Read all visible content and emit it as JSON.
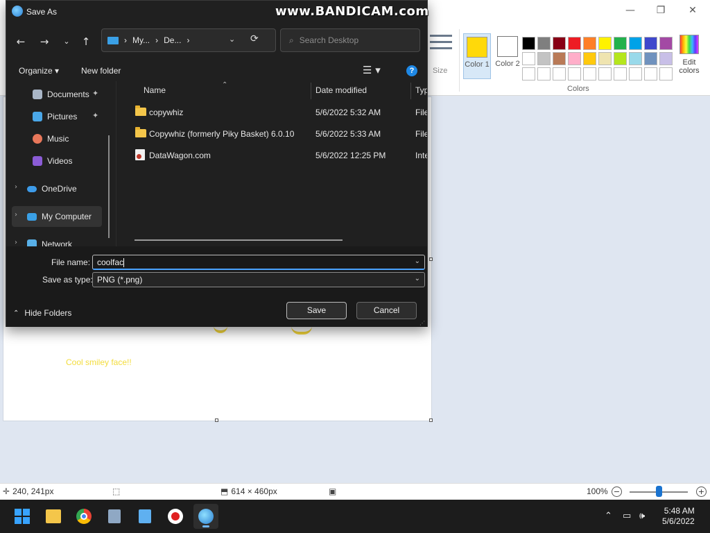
{
  "paint": {
    "window_controls": {
      "minimize": "—",
      "maximize": "❐",
      "close": "✕"
    },
    "ribbon": {
      "size_label": "Size",
      "color1_label": "Color 1",
      "color2_label": "Color 2",
      "colors_group_label": "Colors",
      "edit_colors_label": "Edit colors",
      "color1_value": "#ffd90a",
      "color2_value": "#ffffff",
      "palette_row1": [
        "#000000",
        "#7f7f7f",
        "#880015",
        "#ed1c24",
        "#ff7f27",
        "#fff200",
        "#22b14c",
        "#00a2e8",
        "#3f48cc",
        "#a349a4"
      ],
      "palette_row2": [
        "#ffffff",
        "#c3c3c3",
        "#b97a57",
        "#ffaec9",
        "#ffc90e",
        "#efe4b0",
        "#b5e61d",
        "#99d9ea",
        "#7092be",
        "#c8bfe7"
      ],
      "palette_row3": [
        "#ffffff",
        "#ffffff",
        "#ffffff",
        "#ffffff",
        "#ffffff",
        "#ffffff",
        "#ffffff",
        "#ffffff",
        "#ffffff",
        "#ffffff"
      ]
    },
    "canvas": {
      "text": "Cool smiley face!!"
    },
    "statusbar": {
      "cursor_pos": "240, 241px",
      "image_size": "614 × 460px",
      "zoom": "100%",
      "zoom_level": 0.5
    }
  },
  "dialog": {
    "title": "Save As",
    "watermark": "www.BANDICAM.com",
    "address": {
      "crumb1": "My...",
      "crumb2": "De..."
    },
    "search_placeholder": "Search Desktop",
    "toolbar": {
      "organize": "Organize",
      "new_folder": "New folder"
    },
    "nav_items": [
      {
        "label": "Documents",
        "pinned": true
      },
      {
        "label": "Pictures",
        "pinned": true
      },
      {
        "label": "Music",
        "pinned": false
      },
      {
        "label": "Videos",
        "pinned": false
      },
      {
        "label": "OneDrive",
        "pinned": false
      },
      {
        "label": "My Computer",
        "pinned": false
      },
      {
        "label": "Network",
        "pinned": false
      }
    ],
    "columns": {
      "name": "Name",
      "date": "Date modified",
      "type": "Type"
    },
    "files": [
      {
        "name": "copywhiz",
        "date": "5/6/2022 5:32 AM",
        "type": "File fo",
        "icon": "folder"
      },
      {
        "name": "Copywhiz (formerly Piky Basket) 6.0.10",
        "date": "5/6/2022 5:33 AM",
        "type": "File fo",
        "icon": "folder"
      },
      {
        "name": "DataWagon.com",
        "date": "5/6/2022 12:25 PM",
        "type": "Intern",
        "icon": "web-shortcut"
      }
    ],
    "file_name_label": "File name:",
    "file_name_value": "coolfac",
    "save_type_label": "Save as type:",
    "save_type_value": "PNG (*.png)",
    "hide_folders": "Hide Folders",
    "save_button": "Save",
    "cancel_button": "Cancel"
  },
  "taskbar": {
    "time": "5:48 AM",
    "date": "5/6/2022"
  }
}
